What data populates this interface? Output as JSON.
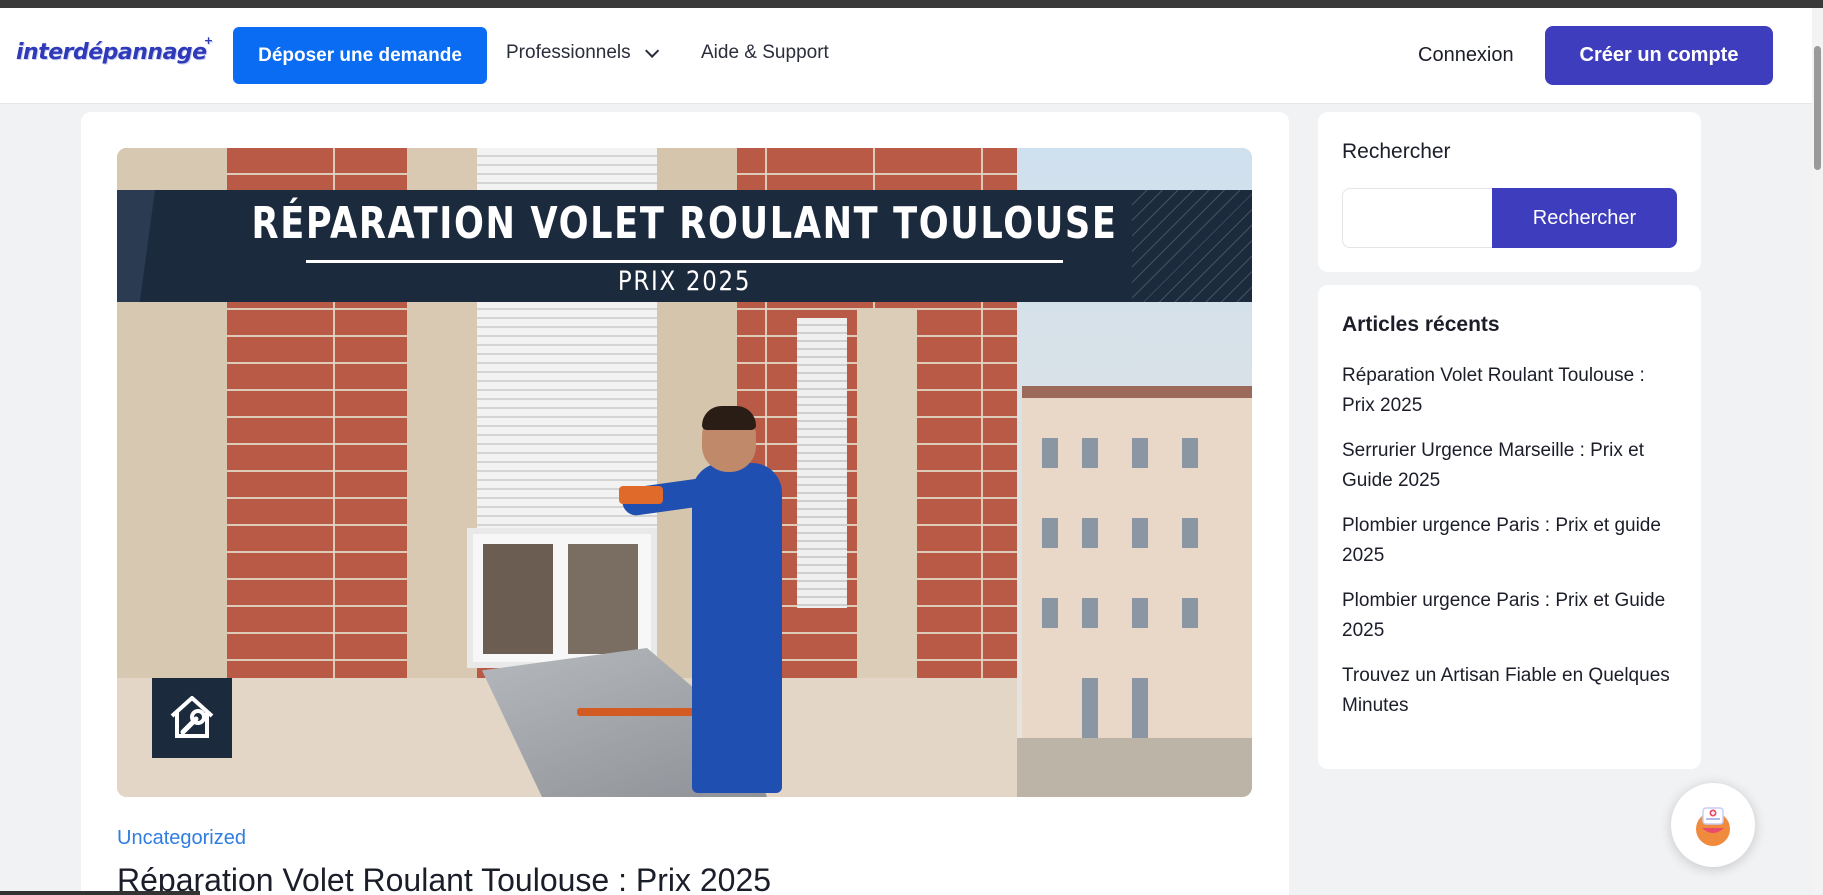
{
  "header": {
    "logo_text": "interdépannage",
    "logo_mark": "+",
    "cta_label": "Déposer une demande",
    "nav": {
      "professionals_label": "Professionnels",
      "support_label": "Aide & Support"
    },
    "login_label": "Connexion",
    "create_account_label": "Créer un compte"
  },
  "post": {
    "hero": {
      "banner_title": "RÉPARATION VOLET ROULANT TOULOUSE",
      "banner_subtitle": "PRIX 2025"
    },
    "category": "Uncategorized",
    "title": "Réparation Volet Roulant Toulouse : Prix 2025"
  },
  "sidebar": {
    "search": {
      "label": "Rechercher",
      "input_value": "",
      "button_label": "Rechercher"
    },
    "recent": {
      "title": "Articles récents",
      "items": [
        "Réparation Volet Roulant Toulouse : Prix 2025",
        "Serrurier Urgence Marseille : Prix et Guide 2025",
        "Plombier urgence Paris : Prix et guide 2025",
        "Plombier urgence Paris : Prix et Guide 2025",
        "Trouvez un Artisan Fiable en Quelques Minutes"
      ]
    }
  },
  "colors": {
    "primary_blue": "#0a6cf2",
    "brand_indigo": "#3d3dbd",
    "category_link": "#2f7de0",
    "banner_navy": "#1c2a3d"
  },
  "icons": {
    "chevron": "chevron-down-icon",
    "badge": "house-wrench-icon",
    "chat": "chat-assistant-icon"
  }
}
